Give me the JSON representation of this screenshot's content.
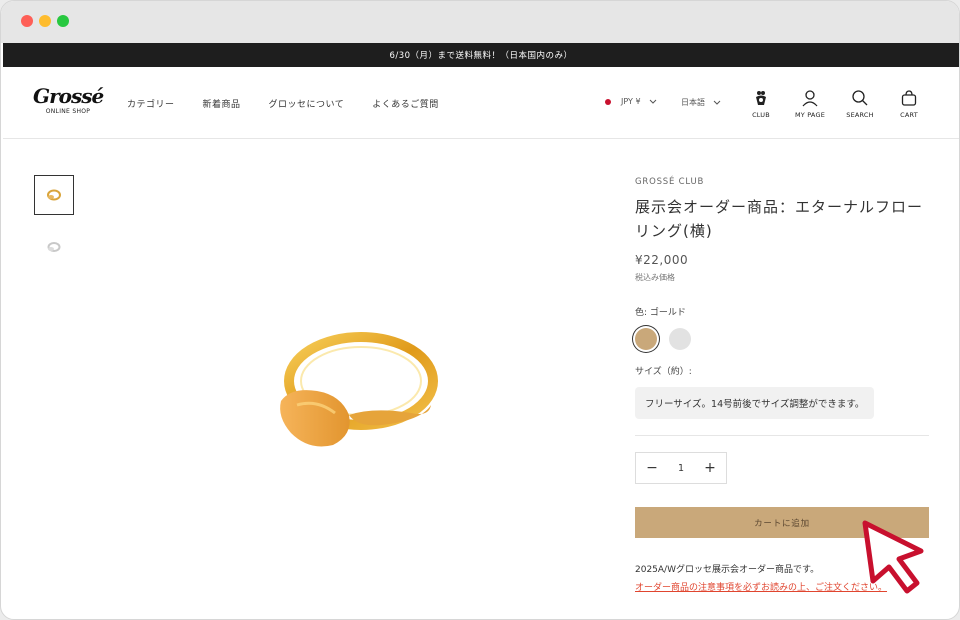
{
  "announcement": "6/30（月）まで送料無料！（日本国内のみ）",
  "logo": {
    "mark": "Grossé",
    "sub": "ONLINE SHOP"
  },
  "nav": [
    {
      "label": "カテゴリー"
    },
    {
      "label": "新着商品"
    },
    {
      "label": "グロッセについて"
    },
    {
      "label": "よくあるご質問"
    }
  ],
  "locale": {
    "currency": "JPY ¥",
    "language": "日本語"
  },
  "header_icons": {
    "club": "CLUB",
    "mypage": "MY PAGE",
    "search": "SEARCH",
    "cart": "CART"
  },
  "product": {
    "brand": "GROSSÉ CLUB",
    "title": "展示会オーダー商品：エターナルフロー リング(横)",
    "price": "¥22,000",
    "tax_note": "税込み価格",
    "color_label": "色: ゴールド",
    "size_label": "サイズ（約）:",
    "size_value": "フリーサイズ。14号前後でサイズ調整ができます。",
    "quantity": "1",
    "add_to_cart": "カートに追加",
    "description": "2025A/Wグロッセ展示会オーダー商品です。",
    "notice_link": "オーダー商品の注意事項を必ずお読みの上、ご注文ください。"
  },
  "colors": {
    "accent": "#c9a87a",
    "announcement_bg": "#1e1e1e",
    "notice": "#e0452f",
    "cursor": "#c8102e"
  }
}
